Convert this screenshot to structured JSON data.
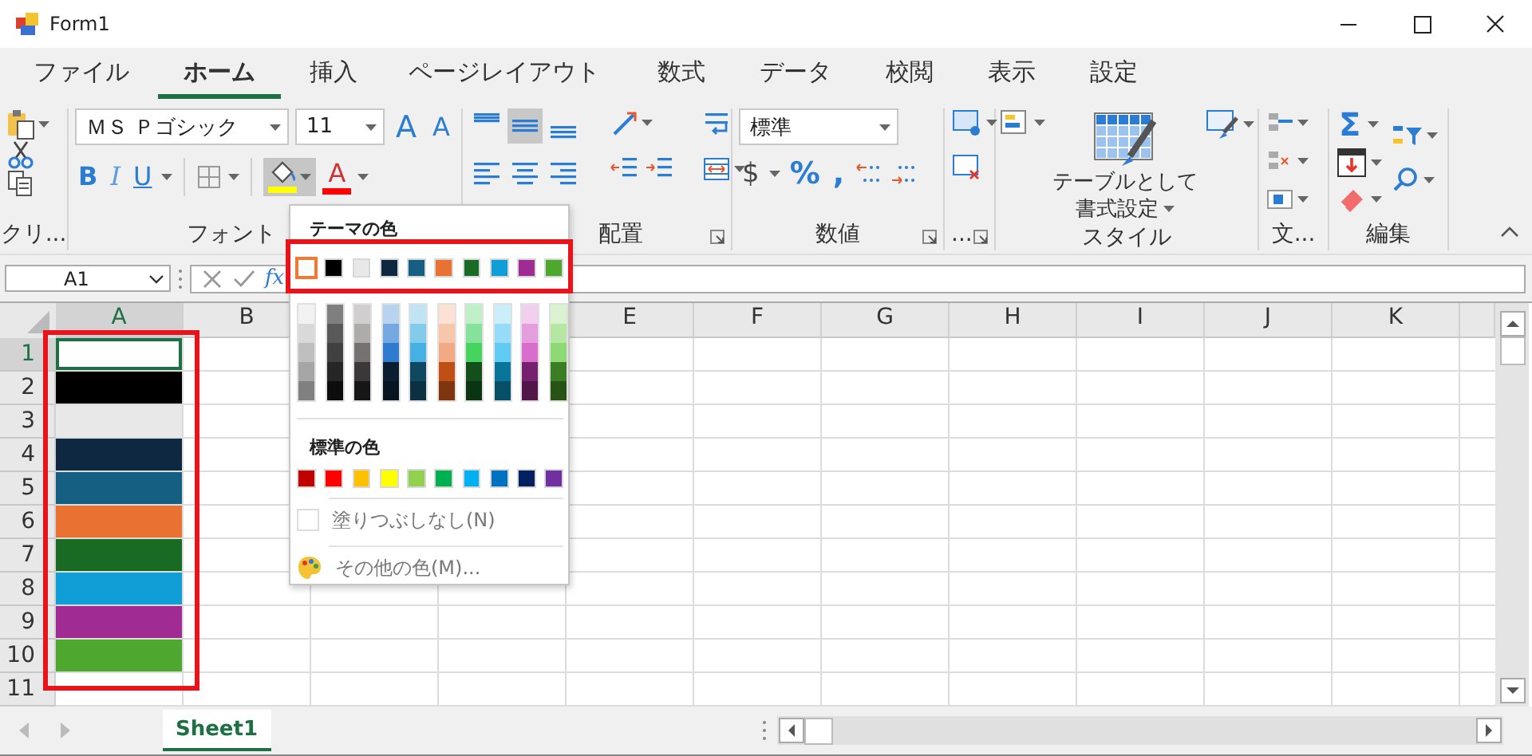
{
  "window": {
    "title": "Form1"
  },
  "tabs": [
    {
      "label": "ファイル",
      "selected": false
    },
    {
      "label": "ホーム",
      "selected": true
    },
    {
      "label": "挿入",
      "selected": false
    },
    {
      "label": "ページレイアウト",
      "selected": false
    },
    {
      "label": "数式",
      "selected": false
    },
    {
      "label": "データ",
      "selected": false
    },
    {
      "label": "校閲",
      "selected": false
    },
    {
      "label": "表示",
      "selected": false
    },
    {
      "label": "設定",
      "selected": false
    }
  ],
  "ribbon": {
    "groups": [
      {
        "kind": "clipboard",
        "label": "クリ..."
      },
      {
        "kind": "font",
        "label": "フォント",
        "font_name": "ＭＳ Ｐゴシック",
        "font_size": "11",
        "grow_label": "A",
        "shrink_label": "A",
        "bold_label": "B",
        "italic_label": "I",
        "underline_label": "U",
        "fill_button": {
          "pressed": true,
          "color": "#ffff00"
        },
        "font_color_button": {
          "label": "A",
          "color": "#ff0000"
        }
      },
      {
        "kind": "alignment",
        "label": "配置",
        "launcher": true,
        "alignments": [
          {
            "selected": false
          },
          {
            "selected": true
          },
          {
            "selected": false
          }
        ]
      },
      {
        "kind": "number",
        "label": "数値",
        "launcher": true,
        "format": "標準",
        "currency_label": "$",
        "percent_label": "%",
        "comma_label": ","
      },
      {
        "kind": "cells",
        "label": "...",
        "launcher": true
      },
      {
        "kind": "styles",
        "label": "スタイル",
        "table_label": "テーブルとして書式設定"
      },
      {
        "kind": "text",
        "label": "文..."
      },
      {
        "kind": "editing",
        "label": "編集",
        "sum_label": "Σ"
      }
    ]
  },
  "formula_bar": {
    "name_box": "A1",
    "function_label": "fx"
  },
  "sheet": {
    "framed": true,
    "columns_left": [
      "A",
      "B"
    ],
    "columns_right": [
      "E",
      "F",
      "G",
      "H",
      "I",
      "J",
      "K"
    ],
    "rows": [
      {
        "header": "1",
        "cells": [
          {
            "color": "#ffffff",
            "selected": true
          }
        ]
      },
      {
        "header": "2",
        "cells": [
          {
            "color": "#000000",
            "selected": false
          }
        ]
      },
      {
        "header": "3",
        "cells": [
          {
            "color": "#e8e8e8",
            "selected": false
          }
        ]
      },
      {
        "header": "4",
        "cells": [
          {
            "color": "#0e2841",
            "selected": false
          }
        ]
      },
      {
        "header": "5",
        "cells": [
          {
            "color": "#156082",
            "selected": false
          }
        ]
      },
      {
        "header": "6",
        "cells": [
          {
            "color": "#e97132",
            "selected": false
          }
        ]
      },
      {
        "header": "7",
        "cells": [
          {
            "color": "#196b24",
            "selected": false
          }
        ]
      },
      {
        "header": "8",
        "cells": [
          {
            "color": "#0f9ed5",
            "selected": false
          }
        ]
      },
      {
        "header": "9",
        "cells": [
          {
            "color": "#a02b93",
            "selected": false
          }
        ]
      },
      {
        "header": "10",
        "cells": [
          {
            "color": "#4ea72e",
            "selected": false
          }
        ]
      },
      {
        "header": "11",
        "cells": []
      }
    ],
    "tabs": [
      {
        "label": "Sheet1",
        "selected": true
      }
    ]
  },
  "color_menu": {
    "theme_framed": true,
    "theme_title": "テーマの色",
    "theme": [
      {
        "color": "#ffffff",
        "selected": true,
        "shades": [
          {
            "color": "#f2f2f2"
          },
          {
            "color": "#d9d9d9"
          },
          {
            "color": "#bfbfbf"
          },
          {
            "color": "#a6a6a6"
          },
          {
            "color": "#808080"
          }
        ]
      },
      {
        "color": "#000000",
        "selected": false,
        "shades": [
          {
            "color": "#7f7f7f"
          },
          {
            "color": "#595959"
          },
          {
            "color": "#404040"
          },
          {
            "color": "#262626"
          },
          {
            "color": "#0d0d0d"
          }
        ]
      },
      {
        "color": "#e8e8e8",
        "selected": false,
        "shades": [
          {
            "color": "#d0cece"
          },
          {
            "color": "#aeabab"
          },
          {
            "color": "#757171"
          },
          {
            "color": "#3a3838"
          },
          {
            "color": "#171616"
          }
        ]
      },
      {
        "color": "#0e2841",
        "selected": false,
        "shades": [
          {
            "color": "#b8d3f0"
          },
          {
            "color": "#74a8e0"
          },
          {
            "color": "#2e7bd0"
          },
          {
            "color": "#0b1e31"
          },
          {
            "color": "#071421"
          }
        ]
      },
      {
        "color": "#156082",
        "selected": false,
        "shades": [
          {
            "color": "#c1e4f5"
          },
          {
            "color": "#83cbeb"
          },
          {
            "color": "#45b0e1"
          },
          {
            "color": "#104862"
          },
          {
            "color": "#0a3041"
          }
        ]
      },
      {
        "color": "#e97132",
        "selected": false,
        "shades": [
          {
            "color": "#fbe2d5"
          },
          {
            "color": "#f7c7ac"
          },
          {
            "color": "#f2aa84"
          },
          {
            "color": "#c04f15"
          },
          {
            "color": "#7f3510"
          }
        ]
      },
      {
        "color": "#196b24",
        "selected": false,
        "shades": [
          {
            "color": "#c0f0c8"
          },
          {
            "color": "#86e29b"
          },
          {
            "color": "#47d45e"
          },
          {
            "color": "#124f1a"
          },
          {
            "color": "#0b3512"
          }
        ]
      },
      {
        "color": "#0f9ed5",
        "selected": false,
        "shades": [
          {
            "color": "#cbeefb"
          },
          {
            "color": "#96dcf8"
          },
          {
            "color": "#62cbf4"
          },
          {
            "color": "#0b7599"
          },
          {
            "color": "#074f66"
          }
        ]
      },
      {
        "color": "#a02b93",
        "selected": false,
        "shades": [
          {
            "color": "#f2cfee"
          },
          {
            "color": "#e59edd"
          },
          {
            "color": "#d86dcd"
          },
          {
            "color": "#77206d"
          },
          {
            "color": "#501549"
          }
        ]
      },
      {
        "color": "#4ea72e",
        "selected": false,
        "shades": [
          {
            "color": "#dbf2d0"
          },
          {
            "color": "#b5e6a2"
          },
          {
            "color": "#8ed973"
          },
          {
            "color": "#3a7d22"
          },
          {
            "color": "#275317"
          }
        ]
      }
    ],
    "standard_title": "標準の色",
    "standard": [
      {
        "color": "#c00000"
      },
      {
        "color": "#ff0000"
      },
      {
        "color": "#ffc000"
      },
      {
        "color": "#ffff00"
      },
      {
        "color": "#92d050"
      },
      {
        "color": "#00b050"
      },
      {
        "color": "#00b0f0"
      },
      {
        "color": "#0070c0"
      },
      {
        "color": "#002060"
      },
      {
        "color": "#7030a0"
      }
    ],
    "items": [
      {
        "kind": "no_fill",
        "label": "塗りつぶしなし(N)"
      },
      {
        "kind": "more_colors",
        "label": "その他の色(M)..."
      }
    ]
  }
}
